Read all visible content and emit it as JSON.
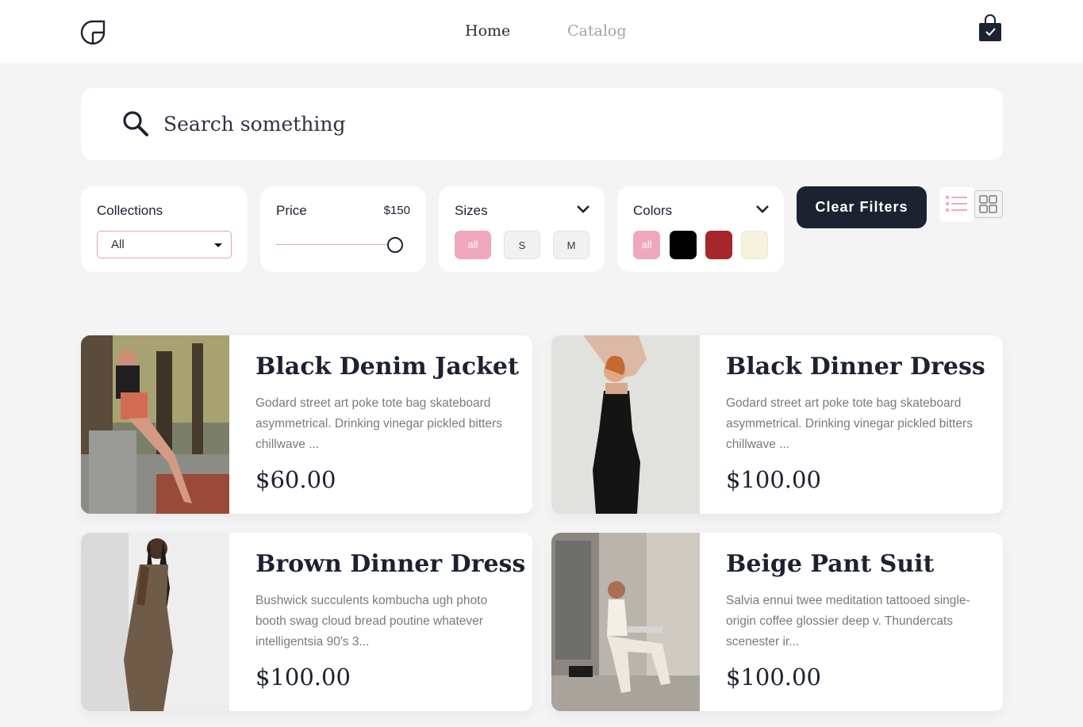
{
  "nav": {
    "home_label": "Home",
    "catalog_label": "Catalog",
    "active": "Home"
  },
  "search": {
    "placeholder": "Search something",
    "value": ""
  },
  "filters": {
    "collections": {
      "label": "Collections",
      "selected": "All"
    },
    "price": {
      "label": "Price",
      "value_text": "$150",
      "slider_fraction": 1.0
    },
    "sizes": {
      "label": "Sizes",
      "options": [
        "all",
        "S",
        "M"
      ],
      "selected": "all"
    },
    "colors": {
      "label": "Colors",
      "all_label": "all",
      "selected": "all",
      "swatches": [
        {
          "name": "black",
          "hex": "#000000"
        },
        {
          "name": "red",
          "hex": "#a7262b"
        },
        {
          "name": "beige",
          "hex": "#f5f3dc"
        }
      ]
    },
    "clear_label": "Clear Filters",
    "view_mode": "list"
  },
  "theme": {
    "accent_pink": "#efa7bc",
    "dark": "#1c2230",
    "background": "#f4f4f4"
  },
  "products": [
    {
      "title": "Black Denim Jacket",
      "description": "Godard street art poke tote bag skateboard asymmetrical. Drinking vinegar pickled bitters chillwave ...",
      "price": "$60.00"
    },
    {
      "title": "Black Dinner Dress",
      "description": "Godard street art poke tote bag skateboard asymmetrical. Drinking vinegar pickled bitters chillwave ...",
      "price": "$100.00"
    },
    {
      "title": "Brown Dinner Dress",
      "description": "Bushwick succulents kombucha ugh photo booth swag cloud bread poutine whatever intelligentsia 90's 3...",
      "price": "$100.00"
    },
    {
      "title": "Beige Pant Suit",
      "description": "Salvia ennui twee meditation tattooed single-origin coffee glossier deep v. Thundercats scenester ir...",
      "price": "$100.00"
    }
  ]
}
